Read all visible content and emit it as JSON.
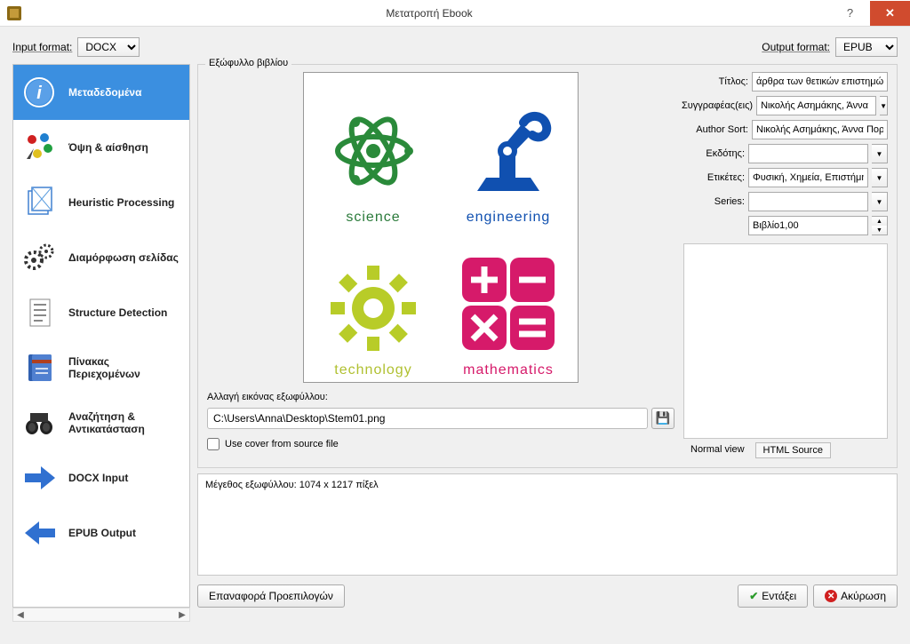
{
  "window": {
    "title": "Μετατροπή Ebook"
  },
  "formats": {
    "input_label": "Input format:",
    "output_label": "Output format:",
    "input_value": "DOCX",
    "output_value": "EPUB"
  },
  "sidebar": {
    "items": [
      {
        "label": "Μεταδεδομένα"
      },
      {
        "label": "Όψη & αίσθηση"
      },
      {
        "label": "Heuristic Processing"
      },
      {
        "label": "Διαμόρφωση σελίδας"
      },
      {
        "label": "Structure Detection"
      },
      {
        "label": "Πίνακας Περιεχομένων"
      },
      {
        "label": "Αναζήτηση & Αντικατάσταση"
      },
      {
        "label": "DOCX Input"
      },
      {
        "label": "EPUB Output"
      }
    ]
  },
  "cover": {
    "group_label": "Εξώφυλλο βιβλίου",
    "change_label": "Αλλαγή εικόνας εξωφύλλου:",
    "path": "C:\\Users\\Anna\\Desktop\\Stem01.png",
    "use_source_label": "Use cover from source file",
    "preview_caps": {
      "science": "science",
      "engineering": "engineering",
      "technology": "technology",
      "mathematics": "mathematics"
    }
  },
  "meta": {
    "title_label": "Τίτλος:",
    "title_value": "άρθρα των θετικών επιστημών",
    "authors_label": "Συγγραφέας(εις)",
    "authors_value": "Νικολής Ασημάκης, Άννα",
    "sort_label": "Author Sort:",
    "sort_value": "Νικολής Ασημάκης, Άννα Πορτ",
    "publisher_label": "Εκδότης:",
    "publisher_value": "",
    "tags_label": "Ετικέτες:",
    "tags_value": "Φυσική, Χημεία, Επιστήμη",
    "series_label": "Series:",
    "series_value": "",
    "book_num": "Βιβλίο1,00",
    "normal_view": "Normal view",
    "html_source": "HTML Source"
  },
  "log": {
    "text": "Μέγεθος εξωφύλλου: 1074 x 1217 πίξελ"
  },
  "buttons": {
    "restore": "Επαναφορά Προεπιλογών",
    "ok": "Εντάξει",
    "cancel": "Ακύρωση"
  }
}
